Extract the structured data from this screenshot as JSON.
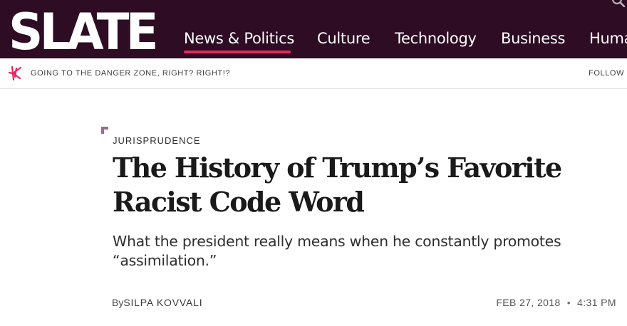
{
  "site": {
    "logo": "SLATE",
    "nav": [
      {
        "label": "News & Politics",
        "active": true
      },
      {
        "label": "Culture",
        "active": false
      },
      {
        "label": "Technology",
        "active": false
      },
      {
        "label": "Business",
        "active": false
      },
      {
        "label": "Human Interest",
        "active": false
      }
    ],
    "search_icon": "search-icon"
  },
  "strip": {
    "icon": "slate-burst-icon",
    "tagline": "GOING TO THE DANGER ZONE, RIGHT? RIGHT!?",
    "follow_label": "FOLLOW"
  },
  "article": {
    "kicker": "JURISPRUDENCE",
    "headline": "The History of Trump’s Favorite Racist Code Word",
    "dek": "What the president really means when he constantly promotes “assimilation.”",
    "byline_prefix": "By",
    "author": "SILPA KOVVALI",
    "date": "FEB 27, 2018",
    "time": "4:31 PM"
  },
  "colors": {
    "header_bg": "#2d0c24",
    "accent": "#e8265e",
    "kicker_mark": "#9c6b91"
  }
}
